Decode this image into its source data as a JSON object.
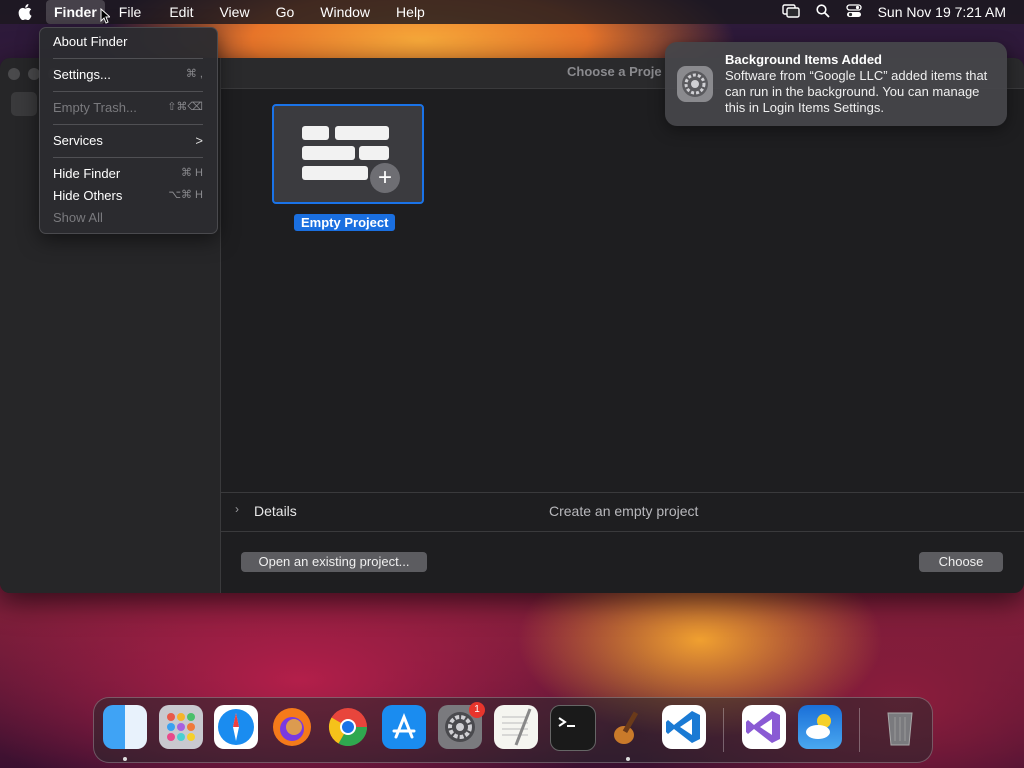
{
  "menubar": {
    "app_name": "Finder",
    "items": [
      "File",
      "Edit",
      "View",
      "Go",
      "Window",
      "Help"
    ],
    "datetime": "Sun Nov 19  7:21 AM"
  },
  "finder_menu": {
    "about": "About Finder",
    "settings": {
      "label": "Settings...",
      "shortcut": "⌘ ,"
    },
    "empty_trash": {
      "label": "Empty Trash...",
      "shortcut": "⇧⌘⌫"
    },
    "services": {
      "label": "Services",
      "arrow": ">"
    },
    "hide_finder": {
      "label": "Hide Finder",
      "shortcut": "⌘ H"
    },
    "hide_others": {
      "label": "Hide Others",
      "shortcut": "⌥⌘ H"
    },
    "show_all": "Show All"
  },
  "project_window": {
    "title": "Choose a Proje",
    "template_label": "Empty Project",
    "details_label": "Details",
    "details_description": "Create an empty project",
    "open_existing": "Open an existing project...",
    "choose": "Choose"
  },
  "notification": {
    "title": "Background Items Added",
    "body": "Software from “Google LLC” added items that can run in the background. You can manage this in Login Items Settings."
  },
  "dock": {
    "apps": [
      "finder-icon",
      "launchpad-icon",
      "safari-icon",
      "firefox-icon",
      "chrome-icon",
      "app-store-icon",
      "system-settings-icon",
      "textedit-icon",
      "terminal-icon",
      "garageband-icon",
      "vscode-icon",
      "visual-studio-icon",
      "weather-icon",
      "trash-icon"
    ],
    "settings_badge": "1"
  }
}
